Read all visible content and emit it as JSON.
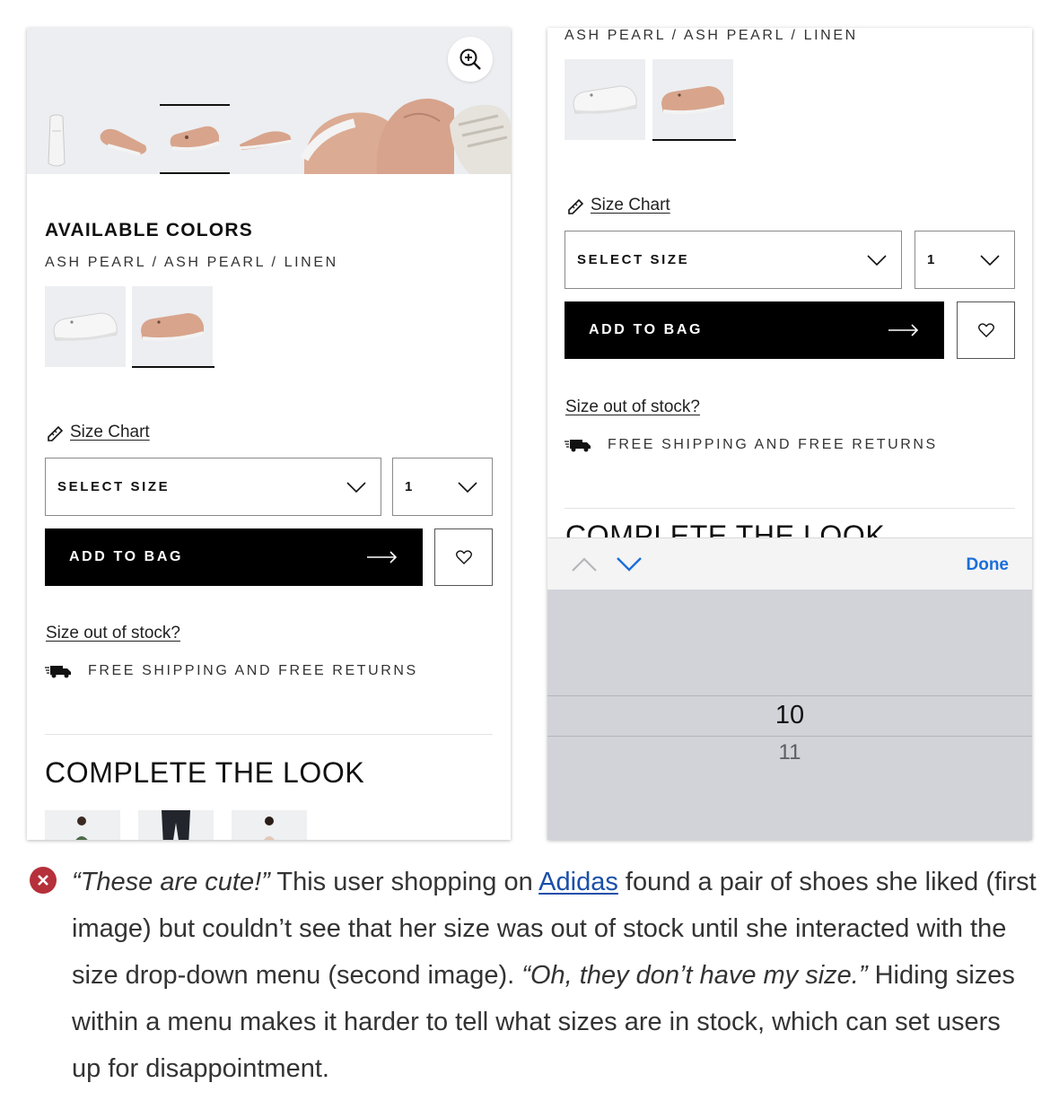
{
  "left": {
    "heading": "AVAILABLE COLORS",
    "color_name": "ASH PEARL / ASH PEARL / LINEN",
    "size_chart": "Size Chart",
    "select_size": "SELECT SIZE",
    "quantity": "1",
    "add_to_bag": "ADD TO BAG",
    "out_of_stock": "Size out of stock?",
    "shipping": "FREE SHIPPING AND FREE RETURNS",
    "complete_look": "COMPLETE THE LOOK"
  },
  "right": {
    "color_name": "ASH PEARL / ASH PEARL / LINEN",
    "size_chart": "Size Chart",
    "select_size": "SELECT SIZE",
    "quantity": "1",
    "add_to_bag": "ADD TO BAG",
    "out_of_stock": "Size out of stock?",
    "shipping": "FREE SHIPPING AND FREE RETURNS",
    "complete_look_partial": "COMPLETE THE LOOK",
    "picker": {
      "done": "Done",
      "selected": "10",
      "next": "11"
    }
  },
  "caption": {
    "quote1": "“These are cute!”",
    "text1": " This user shopping on ",
    "link": "Adidas",
    "text2": " found a pair of shoes she liked (first image) but couldn’t see that her size was out of stock until she interacted with the size drop-down menu (second image). ",
    "quote2": "“Oh, they don’t have my size.”",
    "text3": " Hiding sizes within a menu makes it harder to tell what sizes are in stock, which can set users up for disappointment."
  },
  "colors": {
    "accent_error": "#b5303a",
    "link": "#1a4fa8",
    "ios_done": "#1a6ed8",
    "shoe_pink": "#d8a48c",
    "shoe_white": "#f2f2f2"
  }
}
